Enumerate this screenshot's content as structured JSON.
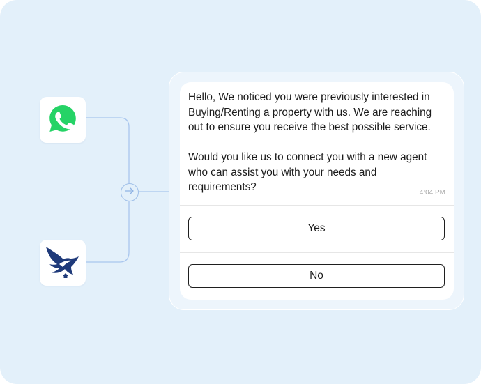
{
  "channels": {
    "source_icon": "whatsapp-icon",
    "source_color": "#25d366",
    "crm_icon": "eagle-house-logo",
    "crm_color": "#1f3a7a",
    "connector_color": "#a9c6ee",
    "hub_icon": "arrow-right-icon"
  },
  "message": {
    "line1": "Hello, We noticed you were previously interested in Buying/Renting a property with us. We are reaching out to ensure you receive the best possible service.",
    "line2": "Would you like us to connect you with a new agent who can assist you with your needs and requirements?",
    "time": "4:04 PM"
  },
  "quick_replies": {
    "yes_label": "Yes",
    "no_label": "No"
  }
}
